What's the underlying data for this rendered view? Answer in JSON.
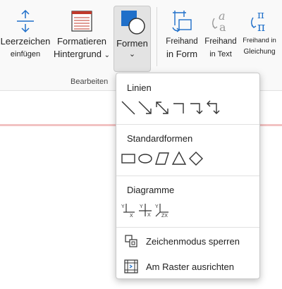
{
  "ribbon": {
    "buttons": {
      "insert_space": {
        "line1": "Leerzeichen",
        "line2": "einfügen"
      },
      "format_background": {
        "line1": "Formatieren",
        "line2": "Hintergrund",
        "arrow": "⌄"
      },
      "shapes": {
        "label": "Formen",
        "arrow": "⌄"
      },
      "ink_to_shape": {
        "line1": "Freihand",
        "line2": "in Form"
      },
      "ink_to_text": {
        "line1": "Freihand",
        "line2": "in Text"
      },
      "ink_to_math": {
        "line1": "Freihand in",
        "line2": "Gleichung"
      }
    },
    "group_label": "Bearbeiten",
    "accent": "#1f6fc9"
  },
  "shapes_menu": {
    "lines_title": "Linien",
    "lines": [
      "line-icon",
      "arrow-icon",
      "double-arrow-icon",
      "elbow-connector-icon",
      "elbow-arrow-icon",
      "elbow-double-arrow-icon"
    ],
    "basic_title": "Standardformen",
    "basic": [
      "rectangle-icon",
      "ellipse-icon",
      "parallelogram-icon",
      "triangle-icon",
      "diamond-icon"
    ],
    "graphs_title": "Diagramme",
    "graphs": [
      {
        "icon": "axis-xy-icon",
        "y": "Y",
        "x": "X"
      },
      {
        "icon": "axis-xy-cross-icon",
        "y": "Y",
        "x": "X"
      },
      {
        "icon": "axis-xyz-icon",
        "y": "Y",
        "x": "ZX"
      }
    ],
    "items": [
      {
        "icon": "lock-drawing-mode-icon",
        "label": "Zeichenmodus sperren"
      },
      {
        "icon": "snap-to-grid-icon",
        "label": "Am Raster ausrichten"
      }
    ]
  }
}
